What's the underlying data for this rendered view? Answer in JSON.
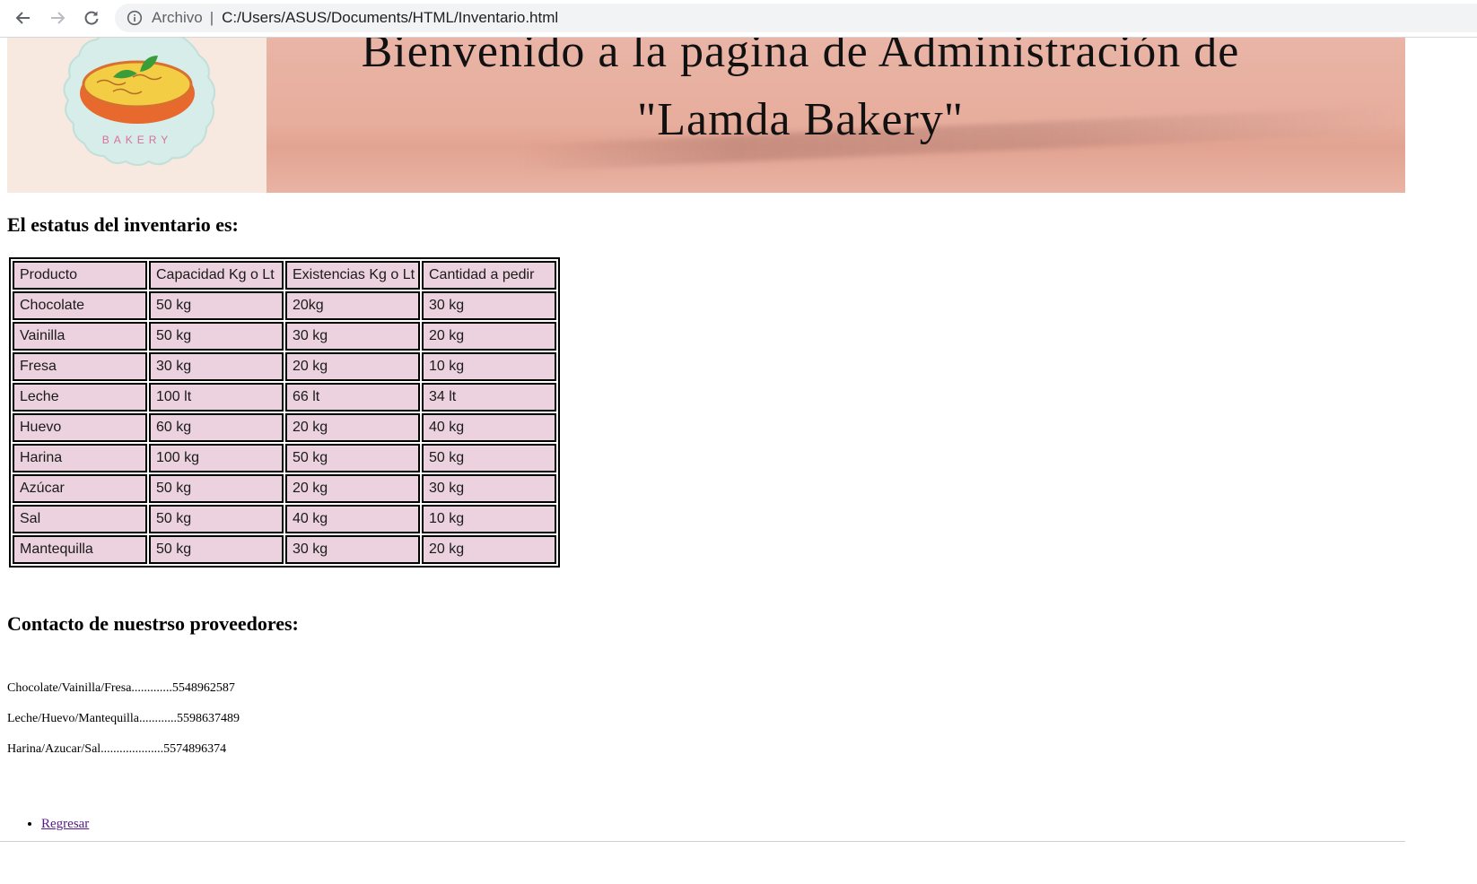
{
  "browser": {
    "scheme_label": "Archivo",
    "separator": "|",
    "url": "C:/Users/ASUS/Documents/HTML/Inventario.html",
    "icons": [
      "back-arrow-icon",
      "forward-arrow-icon",
      "reload-icon",
      "info-icon"
    ]
  },
  "banner": {
    "logo_text": "BAKERY",
    "title_line1": "Bienvenido a la pagina de Administración de",
    "title_line2": "\"Lamda Bakery\"",
    "colors": {
      "logo_bg": "#f7e9df",
      "paper": "#e7ad9d",
      "logo_badge": "#d6ede9",
      "tart_crust": "#e8692e",
      "tart_filling": "#f3cd43",
      "leaf": "#3a9d3a"
    }
  },
  "inventory": {
    "heading": "El estatus del inventario es:",
    "headers": [
      "Producto",
      "Capacidad Kg o Lt",
      "Existencias Kg o Lt",
      "Cantidad a pedir"
    ],
    "rows": [
      [
        "Chocolate",
        "50 kg",
        "20kg",
        "30 kg"
      ],
      [
        "Vainilla",
        "50 kg",
        "30 kg",
        "20 kg"
      ],
      [
        "Fresa",
        "30 kg",
        "20 kg",
        "10 kg"
      ],
      [
        "Leche",
        "100 lt",
        "66 lt",
        "34 lt"
      ],
      [
        "Huevo",
        "60 kg",
        "20 kg",
        "40 kg"
      ],
      [
        "Harina",
        "100 kg",
        "50 kg",
        "50 kg"
      ],
      [
        "Azúcar",
        "50 kg",
        "20 kg",
        "30 kg"
      ],
      [
        "Sal",
        "50 kg",
        "40 kg",
        "10 kg"
      ],
      [
        "Mantequilla",
        "50 kg",
        "30 kg",
        "20 kg"
      ]
    ],
    "cell_color": "#ecd2de"
  },
  "providers": {
    "heading": "Contacto de nuestrso proveedores:",
    "lines": [
      "Chocolate/Vainilla/Fresa.............5548962587",
      "Leche/Huevo/Mantequilla............5598637489",
      "Harina/Azucar/Sal....................5574896374"
    ]
  },
  "links": {
    "back_label": "Regresar"
  }
}
